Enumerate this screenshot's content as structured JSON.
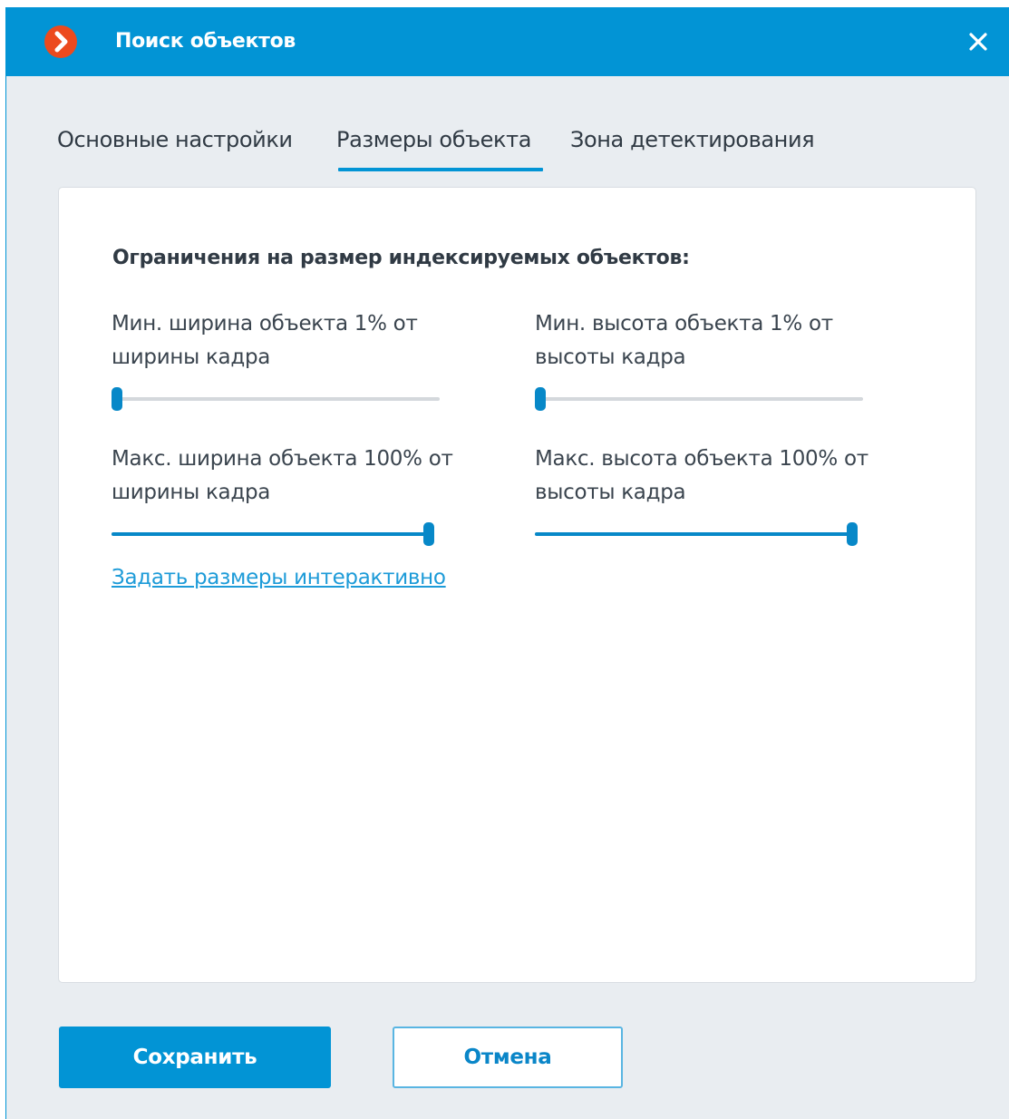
{
  "window": {
    "title": "Поиск объектов",
    "app_icon": "chevron-right-icon",
    "close_icon": "close-icon"
  },
  "tabs": [
    {
      "label": "Основные настройки",
      "active": false
    },
    {
      "label": "Размеры объекта",
      "active": true
    },
    {
      "label": "Зона детектирования",
      "active": false
    }
  ],
  "panel": {
    "section_title": "Ограничения на размер индексируемых объектов:",
    "min_width": {
      "label_line1": "Мин. ширина объекта 1% от",
      "label_line2": "ширины кадра",
      "value_percent": 1
    },
    "min_height": {
      "label_line1": "Мин. высота объекта 1% от",
      "label_line2": "высоты кадра",
      "value_percent": 1
    },
    "max_width": {
      "label_line1": "Макс. ширина объекта 100% от",
      "label_line2": "ширины кадра",
      "value_percent": 100
    },
    "max_height": {
      "label_line1": "Макс. высота объекта 100% от",
      "label_line2": "высоты кадра",
      "value_percent": 100
    },
    "interactive_link": "Задать размеры интерактивно"
  },
  "buttons": {
    "save": "Сохранить",
    "cancel": "Отмена"
  },
  "colors": {
    "accent": "#0294d5",
    "slider": "#0788c8",
    "link": "#1d9bd8",
    "app_icon_bg": "#ec4a1e",
    "background": "#e9edf1"
  }
}
